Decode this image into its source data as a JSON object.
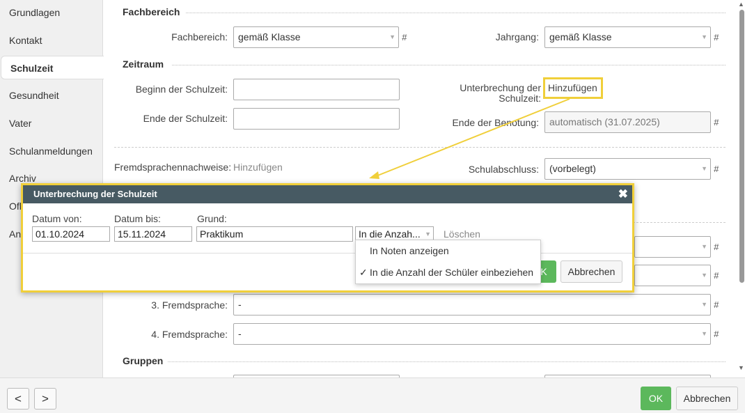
{
  "sidebar": {
    "items": [
      {
        "label": "Grundlagen"
      },
      {
        "label": "Kontakt"
      },
      {
        "label": "Schulzeit"
      },
      {
        "label": "Gesundheit"
      },
      {
        "label": "Vater"
      },
      {
        "label": "Schulanmeldungen"
      },
      {
        "label": "Archiv"
      },
      {
        "label": "Ofl"
      },
      {
        "label": "An"
      }
    ]
  },
  "fachbereich": {
    "title": "Fachbereich",
    "fachbereich_label": "Fachbereich:",
    "fachbereich_value": "gemäß Klasse",
    "jahrgang_label": "Jahrgang:",
    "jahrgang_value": "gemäß Klasse"
  },
  "zeitraum": {
    "title": "Zeitraum",
    "beginn_label": "Beginn der Schulzeit:",
    "beginn_value": "",
    "ende_label": "Ende der Schulzeit:",
    "ende_value": "",
    "unterbrechung_label_1": "Unterbrechung der",
    "unterbrechung_label_2": "Schulzeit:",
    "unterbrechung_button": "Hinzufügen",
    "ende_benotung_label": "Ende der Benotung:",
    "ende_benotung_value": "automatisch (31.07.2025)",
    "fremdsprachen_label": "Fremdsprachennachweise:",
    "fremdsprachen_link": "Hinzufügen",
    "schulabschluss_label": "Schulabschluss:",
    "schulabschluss_value": "(vorbelegt)"
  },
  "sprachen": {
    "third_label": "3. Fremdsprache:",
    "third_value": "-",
    "fourth_label": "4. Fremdsprache:",
    "fourth_value": "-"
  },
  "gruppen": {
    "title": "Gruppen"
  },
  "hash": "#",
  "dialog": {
    "title": "Unterbrechung der Schulzeit",
    "close": "✖",
    "datum_von_label": "Datum von:",
    "datum_von_value": "01.10.2024",
    "datum_bis_label": "Datum bis:",
    "datum_bis_value": "15.11.2024",
    "grund_label": "Grund:",
    "grund_value": "Praktikum",
    "select_value": "In die Anzah...",
    "loeschen": "Löschen",
    "ok_partial": "K",
    "abbrechen": "Abbrechen"
  },
  "dropdown": {
    "options": [
      {
        "label": "In Noten anzeigen",
        "checked": false
      },
      {
        "label": "In die Anzahl der Schüler einbeziehen",
        "checked": true
      }
    ],
    "check_glyph": "✓"
  },
  "footer": {
    "prev": "<",
    "next": ">",
    "ok": "OK",
    "abbrechen": "Abbrechen"
  },
  "colors": {
    "highlight": "#f0cf3a",
    "dialog_header": "#475a63",
    "ok_green": "#5cb85c"
  }
}
